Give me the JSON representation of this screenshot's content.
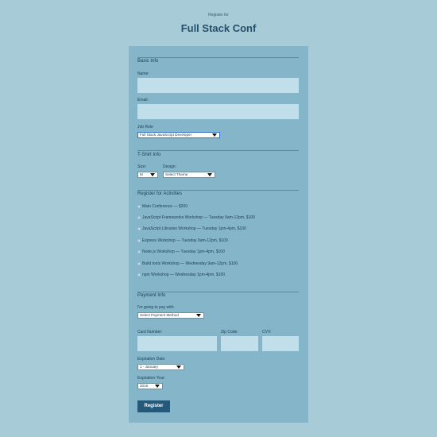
{
  "header": {
    "kicker": "Register for",
    "title": "Full Stack Conf"
  },
  "basic_info": {
    "title": "Basic Info",
    "name_label": "Name:",
    "name_value": "",
    "email_label": "Email:",
    "email_value": "",
    "job_role_label": "Job Role",
    "job_role_value": "Full Stack JavaScript Developer"
  },
  "tshirt": {
    "title": "T-Shirt Info",
    "size_label": "Size:",
    "size_value": "M",
    "design_label": "Design:",
    "design_value": "Select Theme"
  },
  "activities": {
    "title": "Register for Activities",
    "items": [
      {
        "label": "Main Conference — $200",
        "checked": false
      },
      {
        "label": "JavaScript Frameworks Workshop — Tuesday 9am-12pm, $100",
        "checked": false
      },
      {
        "label": "JavaScript Libraries Workshop — Tuesday 1pm-4pm, $100",
        "checked": false
      },
      {
        "label": "Express Workshop — Tuesday 9am-12pm, $100",
        "checked": false
      },
      {
        "label": "Node.js Workshop — Tuesday 1pm-4pm, $100",
        "checked": false
      },
      {
        "label": "Build tools Workshop — Wednesday 9am-12pm, $100",
        "checked": false
      },
      {
        "label": "npm Workshop — Wednesday 1pm-4pm, $100",
        "checked": false
      }
    ]
  },
  "payment": {
    "title": "Payment Info",
    "pay_with_label": "I'm going to pay with:",
    "pay_with_value": "Select Payment Method",
    "card_number_label": "Card Number:",
    "zip_label": "Zip Code:",
    "cvv_label": "CVV:",
    "exp_date_label": "Expiration Date:",
    "exp_date_value": "1 - January",
    "exp_year_label": "Expiration Year:",
    "exp_year_value": "2016"
  },
  "register_button": "Register",
  "colors": {
    "page_bg": "#a8cbd8",
    "card_bg": "#85b5c9",
    "input_bg": "#c0dfeb",
    "button_bg": "#24597a",
    "title": "#23506a"
  }
}
